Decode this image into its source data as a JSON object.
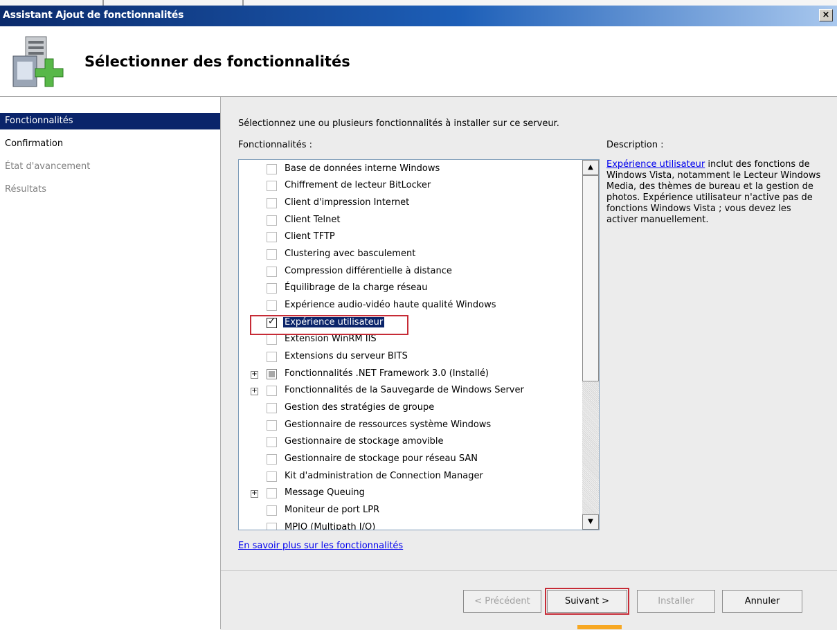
{
  "window": {
    "title": "Assistant Ajout de fonctionnalités",
    "close_glyph": "×"
  },
  "header": {
    "title": "Sélectionner des fonctionnalités",
    "icon": "server-add-icon"
  },
  "nav": [
    {
      "label": "Fonctionnalités",
      "state": "active"
    },
    {
      "label": "Confirmation",
      "state": "normal"
    },
    {
      "label": "État d'avancement",
      "state": "disabled"
    },
    {
      "label": "Résultats",
      "state": "disabled"
    }
  ],
  "main": {
    "instruction": "Sélectionnez une ou plusieurs fonctionnalités à installer sur ce serveur.",
    "features_label": "Fonctionnalités :",
    "description_label": "Description :",
    "learn_more": "En savoir plus sur les fonctionnalités"
  },
  "features": [
    {
      "label": "Base de données interne Windows",
      "checked": false,
      "expandable": false
    },
    {
      "label": "Chiffrement de lecteur BitLocker",
      "checked": false,
      "expandable": false
    },
    {
      "label": "Client d'impression Internet",
      "checked": false,
      "expandable": false
    },
    {
      "label": "Client Telnet",
      "checked": false,
      "expandable": false
    },
    {
      "label": "Client TFTP",
      "checked": false,
      "expandable": false
    },
    {
      "label": "Clustering avec basculement",
      "checked": false,
      "expandable": false
    },
    {
      "label": "Compression différentielle à distance",
      "checked": false,
      "expandable": false
    },
    {
      "label": "Équilibrage de la charge réseau",
      "checked": false,
      "expandable": false
    },
    {
      "label": "Expérience audio-vidéo haute qualité Windows",
      "checked": false,
      "expandable": false
    },
    {
      "label": "Expérience utilisateur",
      "checked": true,
      "expandable": false,
      "selected": true
    },
    {
      "label": "Extension WinRM IIS",
      "checked": false,
      "expandable": false
    },
    {
      "label": "Extensions du serveur BITS",
      "checked": false,
      "expandable": false
    },
    {
      "label": "Fonctionnalités .NET Framework 3.0  (Installé)",
      "checked": false,
      "installed": true,
      "expandable": true
    },
    {
      "label": "Fonctionnalités de la Sauvegarde de Windows Server",
      "checked": false,
      "expandable": true
    },
    {
      "label": "Gestion des stratégies de groupe",
      "checked": false,
      "expandable": false
    },
    {
      "label": "Gestionnaire de ressources système Windows",
      "checked": false,
      "expandable": false
    },
    {
      "label": "Gestionnaire de stockage amovible",
      "checked": false,
      "expandable": false
    },
    {
      "label": "Gestionnaire de stockage pour réseau SAN",
      "checked": false,
      "expandable": false
    },
    {
      "label": "Kit d'administration de Connection Manager",
      "checked": false,
      "expandable": false
    },
    {
      "label": "Message Queuing",
      "checked": false,
      "expandable": true
    },
    {
      "label": "Moniteur de port LPR",
      "checked": false,
      "expandable": false
    },
    {
      "label": "MPIO (Multipath I/O)",
      "checked": false,
      "expandable": false
    }
  ],
  "description": {
    "link": "Expérience utilisateur",
    "text": " inclut des fonctions de Windows Vista, notamment le Lecteur Windows Media, des thèmes de bureau et la gestion de photos. Expérience utilisateur n'active pas de fonctions Windows Vista ; vous devez les activer manuellement."
  },
  "buttons": {
    "prev": "< Précédent",
    "next": "Suivant >",
    "install": "Installer",
    "cancel": "Annuler"
  },
  "scrollbar": {
    "up": "▲",
    "down": "▼"
  },
  "colors": {
    "accent": "#0a246a",
    "highlight": "#c62b36"
  }
}
